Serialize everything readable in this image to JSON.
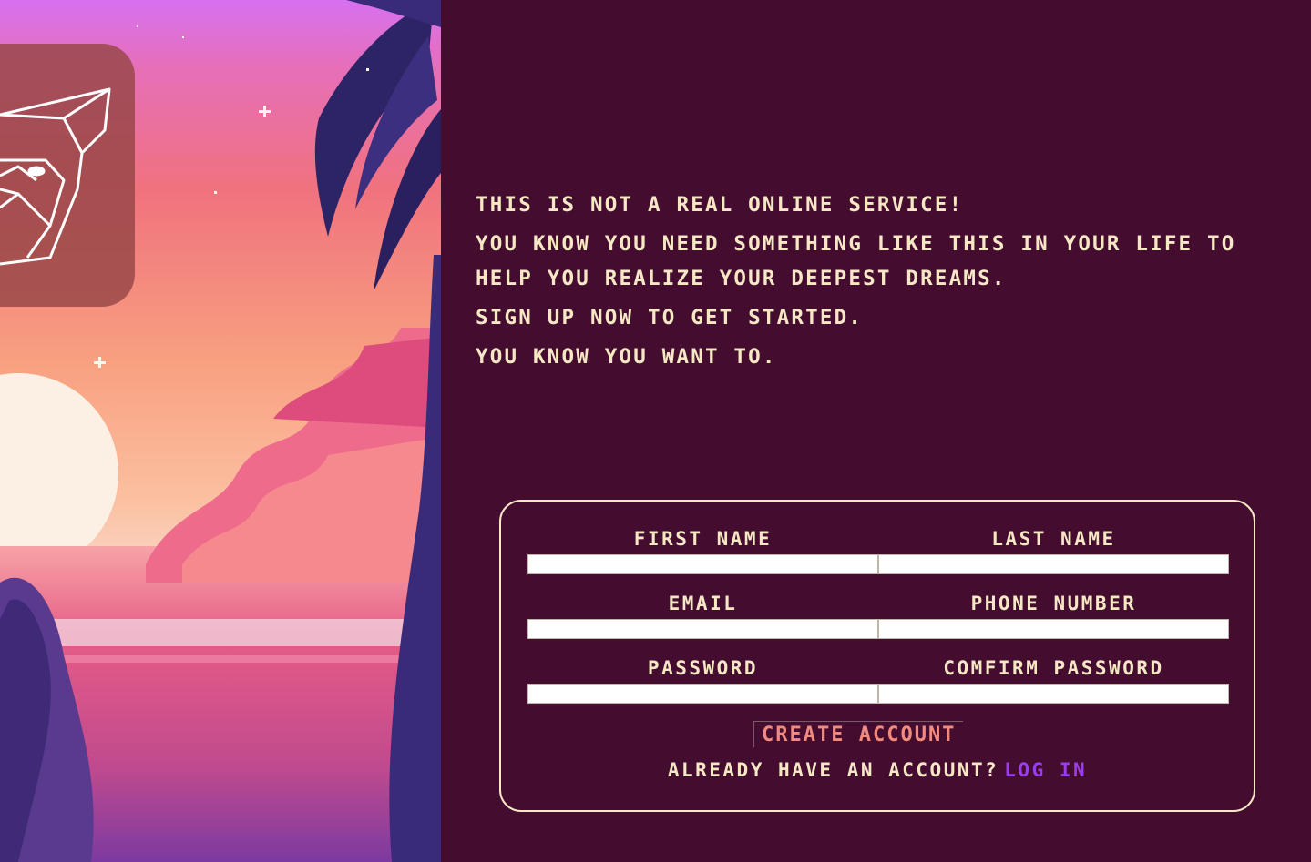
{
  "colors": {
    "background": "#440d30",
    "text": "#f6e8c4",
    "accent_button": "#f38a7e",
    "link": "#9a3cf0",
    "input_bg": "#ffffff"
  },
  "hero": {
    "image": "pixel-art-sunset-beach-with-palm-tree",
    "logo_icon": "origami-fox-head-icon"
  },
  "intro": {
    "line1": "This is not a real online service!",
    "line2": "You know you need something like this in your life to help you realize your deepest dreams.",
    "line3": "Sign up now to get started.",
    "line4": "You know you want to."
  },
  "form": {
    "fields": [
      {
        "label": "First Name",
        "value": ""
      },
      {
        "label": "Last Name",
        "value": ""
      },
      {
        "label": "Email",
        "value": ""
      },
      {
        "label": "Phone Number",
        "value": ""
      },
      {
        "label": "Password",
        "value": ""
      },
      {
        "label": "Comfirm Password",
        "value": ""
      }
    ],
    "submit_label": "Create Account",
    "login_prompt": "Already have an account?",
    "login_link": "Log in"
  }
}
